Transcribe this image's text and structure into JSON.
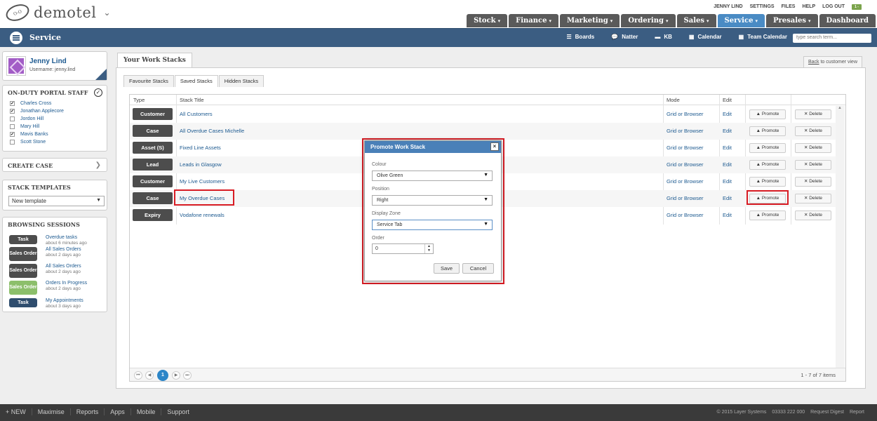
{
  "app": {
    "logo_text": "demotel",
    "logo_mark": "O-O",
    "top_links": [
      "JENNY LIND",
      "SETTINGS",
      "FILES",
      "HELP",
      "LOG OUT"
    ],
    "flag_label": "1 -",
    "main_tabs": [
      {
        "label": "Stock",
        "active": false
      },
      {
        "label": "Finance",
        "active": false
      },
      {
        "label": "Marketing",
        "active": false
      },
      {
        "label": "Ordering",
        "active": false
      },
      {
        "label": "Sales",
        "active": false
      },
      {
        "label": "Service",
        "active": true
      },
      {
        "label": "Presales",
        "active": false
      },
      {
        "label": "Dashboard",
        "active": false
      }
    ]
  },
  "service_bar": {
    "title": "Service",
    "links": [
      "Boards",
      "Natter",
      "KB",
      "Calendar",
      "Team Calendar"
    ],
    "search_placeholder": "type search term..."
  },
  "user": {
    "name": "Jenny Lind",
    "username": "Username: jenny.lind"
  },
  "staff": {
    "title": "ON-DUTY PORTAL STAFF",
    "members": [
      {
        "name": "Charles Cross",
        "checked": true
      },
      {
        "name": "Jonathan Applecore",
        "checked": true
      },
      {
        "name": "Jordon Hill",
        "checked": false
      },
      {
        "name": "Mary Hill",
        "checked": false
      },
      {
        "name": "Mavis Banks",
        "checked": true
      },
      {
        "name": "Scott Stone",
        "checked": false
      }
    ]
  },
  "create_case": {
    "title": "CREATE CASE"
  },
  "templates": {
    "title": "STACK TEMPLATES",
    "selected": "New template"
  },
  "sessions": {
    "title": "BROWSING SESSIONS",
    "items": [
      {
        "badge": "Task",
        "color": "#4d4d4d",
        "title": "Overdue tasks",
        "ago": "about 6 minutes ago"
      },
      {
        "badge": "Sales Order",
        "color": "#4d4d4d",
        "title": "All Sales Orders",
        "ago": "about 2 days ago"
      },
      {
        "badge": "Sales Order",
        "color": "#4d4d4d",
        "title": "All Sales Orders",
        "ago": "about 2 days ago"
      },
      {
        "badge": "Sales Order",
        "color": "#8cbf6b",
        "title": "Orders In Progress",
        "ago": "about 2 days ago"
      },
      {
        "badge": "Task",
        "color": "#2f4d6e",
        "title": "My Appointments",
        "ago": "about 3 days ago"
      }
    ]
  },
  "main": {
    "section_title": "Your Work Stacks",
    "back_prefix": "Back",
    "back_rest": " to customer view",
    "subtabs": [
      {
        "label": "Favourite Stacks",
        "active": false
      },
      {
        "label": "Saved Stacks",
        "active": true
      },
      {
        "label": "Hidden Stacks",
        "active": false
      }
    ],
    "columns": [
      "Type",
      "Stack Title",
      "Mode",
      "Edit"
    ],
    "rows": [
      {
        "type": "Customer",
        "title": "All Customers",
        "mode": "Grid or Browser",
        "edit": "Edit",
        "promote": "Promote",
        "delete": "Delete"
      },
      {
        "type": "Case",
        "title": "All Overdue Cases Michelle",
        "mode": "Grid or Browser",
        "edit": "Edit",
        "promote": "Promote",
        "delete": "Delete"
      },
      {
        "type": "Asset (S)",
        "title": "Fixed Line Assets",
        "mode": "Grid or Browser",
        "edit": "Edit",
        "promote": "Promote",
        "delete": "Delete"
      },
      {
        "type": "Lead",
        "title": "Leads in Glasgow",
        "mode": "Grid or Browser",
        "edit": "Edit",
        "promote": "Promote",
        "delete": "Delete"
      },
      {
        "type": "Customer",
        "title": "My Live Customers",
        "mode": "Grid or Browser",
        "edit": "Edit",
        "promote": "Promote",
        "delete": "Delete"
      },
      {
        "type": "Case",
        "title": "My Overdue Cases",
        "mode": "Grid or Browser",
        "edit": "Edit",
        "promote": "Promote",
        "delete": "Delete"
      },
      {
        "type": "Expiry",
        "title": "Vodafone renewals",
        "mode": "Grid or Browser",
        "edit": "Edit",
        "promote": "Promote",
        "delete": "Delete"
      }
    ],
    "pager": {
      "current": "1",
      "count": "1 - 7 of 7 items"
    }
  },
  "modal": {
    "title": "Promote Work Stack",
    "close": "×",
    "colour_label": "Colour",
    "colour_value": "Olive Green",
    "position_label": "Position",
    "position_value": "Right",
    "zone_label": "Display Zone",
    "zone_value": "Service Tab",
    "order_label": "Order",
    "order_value": "0",
    "save": "Save",
    "cancel": "Cancel"
  },
  "footer": {
    "links": [
      "+ NEW",
      "Maximise",
      "Reports",
      "Apps",
      "Mobile",
      "Support"
    ],
    "copyright": "© 2015 Layer Systems",
    "phone": "03333 222 000",
    "digest": "Request Digest",
    "report": "Report"
  }
}
